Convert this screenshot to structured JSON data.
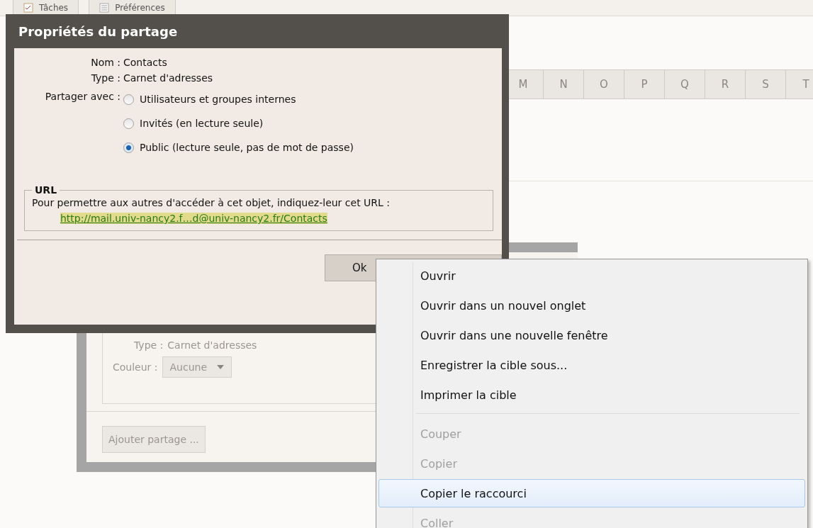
{
  "background": {
    "tabs": [
      {
        "label": "Tâches",
        "kind": "tasks"
      },
      {
        "label": "Préférences",
        "kind": "prefs"
      }
    ],
    "letters": [
      "M",
      "N",
      "O",
      "P",
      "Q",
      "R",
      "S",
      "T"
    ]
  },
  "dialog_behind": {
    "disabled": true,
    "type_row": {
      "label": "Type :",
      "value": "Carnet d'adresses"
    },
    "color_row": {
      "label": "Couleur :",
      "value": "Aucune"
    },
    "add_button": "Ajouter partage ..."
  },
  "dialog": {
    "title": "Propriétés du partage",
    "name_row": {
      "label": "Nom :",
      "value": "Contacts"
    },
    "type_row": {
      "label": "Type :",
      "value": "Carnet d'adresses"
    },
    "share_with_label": "Partager avec :",
    "options": [
      {
        "label": "Utilisateurs et groupes internes",
        "selected": false
      },
      {
        "label": "Invités (en lecture seule)",
        "selected": false
      },
      {
        "label": "Public (lecture seule, pas de mot de passe)",
        "selected": true
      }
    ],
    "url_section": {
      "legend": "URL",
      "instruction": "Pour permettre aux autres d'accéder à cet objet, indiquez-leur cet URL :",
      "link": "http://mail.univ-nancy2.f…d@univ-nancy2.fr/Contacts"
    },
    "ok_button": "Ok"
  },
  "context_menu": {
    "groups": [
      [
        {
          "label": "Ouvrir",
          "disabled": false,
          "selected": false
        },
        {
          "label": "Ouvrir dans un nouvel onglet",
          "disabled": false,
          "selected": false
        },
        {
          "label": "Ouvrir dans une nouvelle fenêtre",
          "disabled": false,
          "selected": false
        },
        {
          "label": "Enregistrer la cible sous...",
          "disabled": false,
          "selected": false
        },
        {
          "label": "Imprimer la cible",
          "disabled": false,
          "selected": false
        }
      ],
      [
        {
          "label": "Couper",
          "disabled": true,
          "selected": false
        },
        {
          "label": "Copier",
          "disabled": true,
          "selected": false
        },
        {
          "label": "Copier le raccourci",
          "disabled": false,
          "selected": true
        },
        {
          "label": "Coller",
          "disabled": true,
          "selected": false
        }
      ]
    ]
  }
}
